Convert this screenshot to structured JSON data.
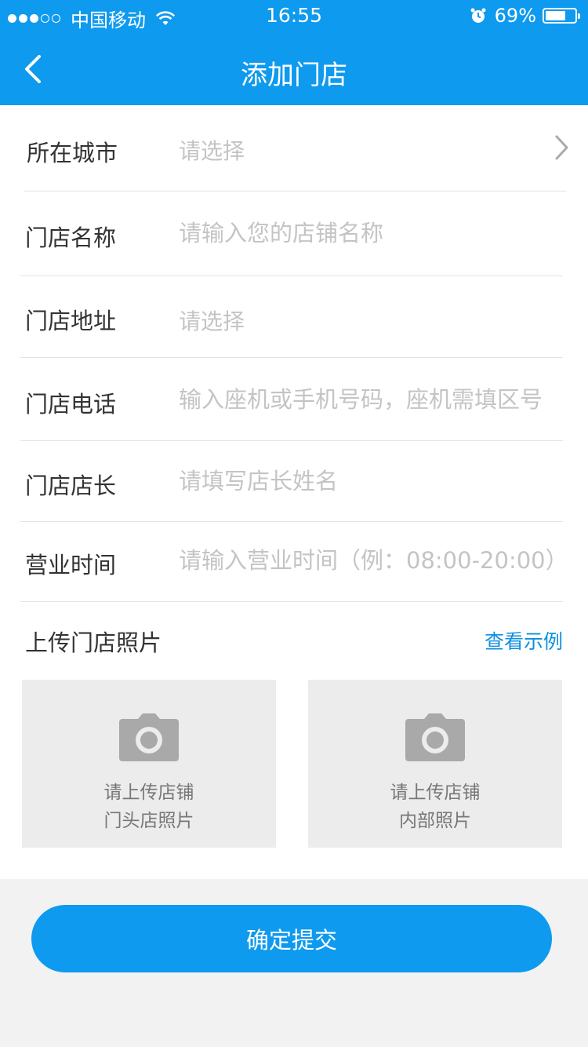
{
  "status_bar": {
    "carrier": "中国移动",
    "time": "16:55",
    "battery": "69%",
    "battery_level": 0.69,
    "signal_bars": 3,
    "icons": [
      "wifi-icon",
      "alarm-icon",
      "battery-icon"
    ]
  },
  "nav": {
    "title": "添加门店",
    "back_icon": "chevron-left-icon"
  },
  "form": {
    "city": {
      "label": "所在城市",
      "placeholder": "请选择"
    },
    "name": {
      "label": "门店名称",
      "placeholder": "请输入您的店铺名称"
    },
    "address": {
      "label": "门店地址",
      "placeholder": "请选择"
    },
    "phone": {
      "label": "门店电话",
      "placeholder": "输入座机或手机号码，座机需填区号"
    },
    "manager": {
      "label": "门店店长",
      "placeholder": "请填写店长姓名"
    },
    "hours": {
      "label": "营业时间",
      "placeholder": "请输入营业时间（例：08:00-20:00）"
    }
  },
  "upload": {
    "title": "上传门店照片",
    "example_link": "查看示例",
    "front": {
      "line1": "请上传店铺",
      "line2": "门头店照片"
    },
    "interior": {
      "line1": "请上传店铺",
      "line2": "内部照片"
    }
  },
  "submit_label": "确定提交",
  "colors": {
    "brand": "#0e9aee",
    "link": "#0e8fe0",
    "placeholder": "#c4c4c4",
    "photo_bg": "#ececec"
  }
}
